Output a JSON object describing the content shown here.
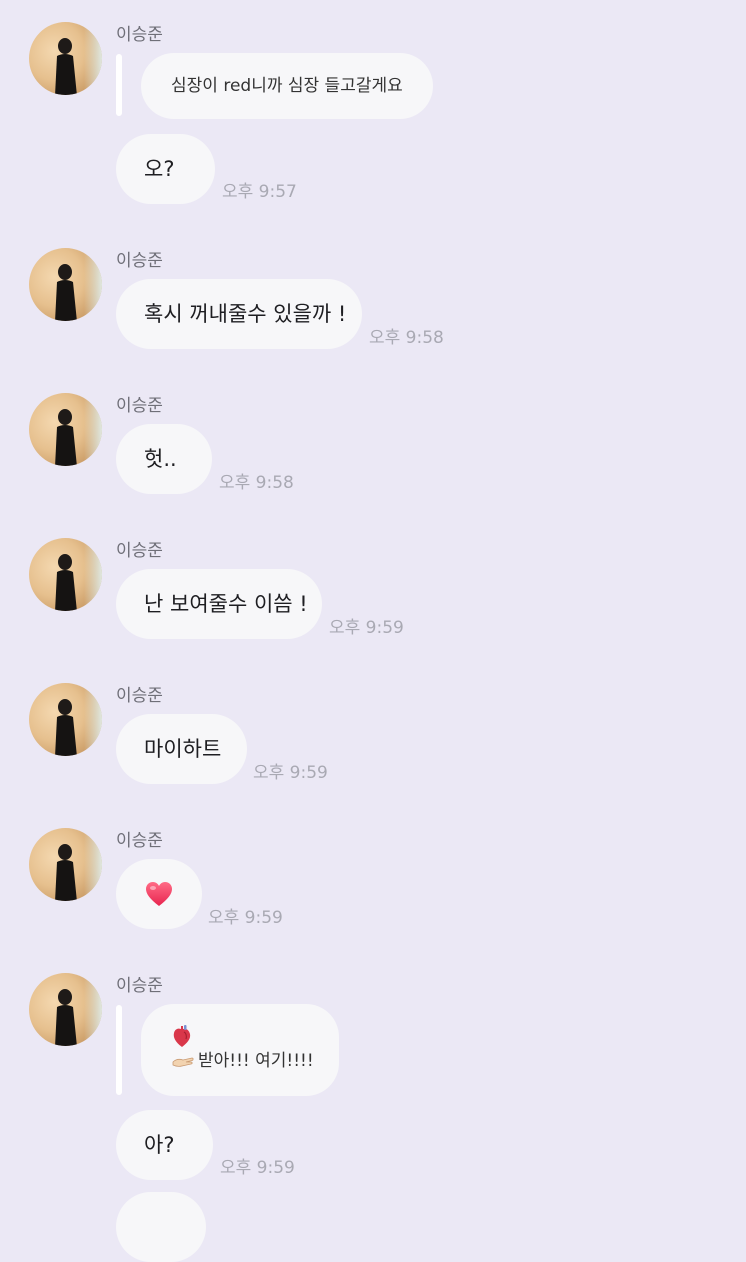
{
  "sender_name": "이승준",
  "messages": [
    {
      "quote": "심장이 red니까 심장 들고갈게요",
      "text": "오?",
      "time": "오후 9:57"
    },
    {
      "text": "혹시 꺼내줄수 있을까 !",
      "time": "오후 9:58"
    },
    {
      "text": "헛..",
      "time": "오후 9:58"
    },
    {
      "text": "난 보여줄수 이씀 !",
      "time": "오후 9:59"
    },
    {
      "text": "마이하트",
      "time": "오후 9:59"
    },
    {
      "emoji": "heart",
      "time": "오후 9:59"
    },
    {
      "quote_line2": "받아!!! 여기!!!!",
      "text": "아?",
      "time": "오후 9:59"
    }
  ],
  "icons": {
    "heart": "heart-emoji",
    "anatomical_heart": "anatomical-heart-icon",
    "palm_up_hand": "palm-up-hand-icon"
  },
  "colors": {
    "background": "#ebe8f5",
    "bubble": "#f7f7f9",
    "time_text": "#a9a9b3",
    "name_text": "#6f6f78",
    "heart": "#f0486a"
  }
}
